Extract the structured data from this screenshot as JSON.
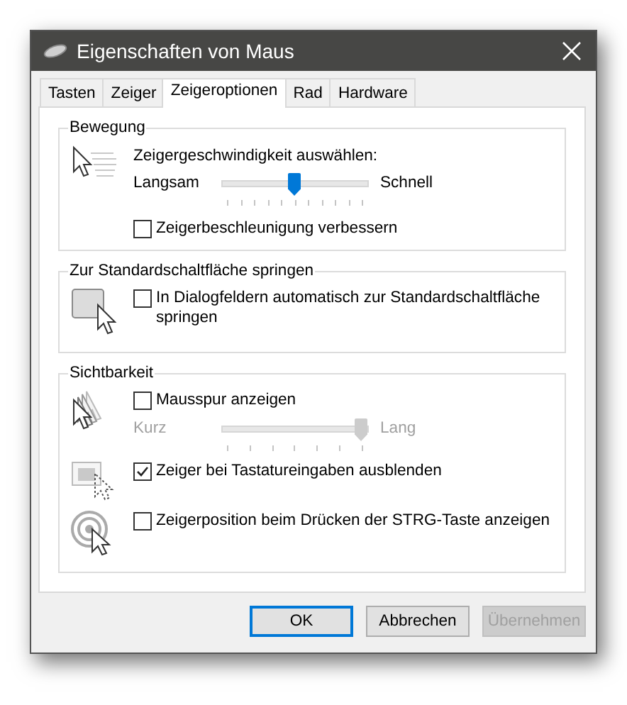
{
  "window": {
    "title": "Eigenschaften von Maus"
  },
  "tabs": [
    {
      "label": "Tasten",
      "selected": false
    },
    {
      "label": "Zeiger",
      "selected": false
    },
    {
      "label": "Zeigeroptionen",
      "selected": true
    },
    {
      "label": "Rad",
      "selected": false
    },
    {
      "label": "Hardware",
      "selected": false
    }
  ],
  "groups": [
    {
      "title": "Bewegung",
      "blocks": [
        {
          "rows": [
            {
              "kind": "label",
              "text": "Zeigergeschwindigkeit auswählen:"
            },
            {
              "kind": "slider",
              "min_label": "Langsam",
              "max_label": "Schnell",
              "level": 0.5,
              "disabled": false
            },
            {
              "kind": "checkbox",
              "label": "Zeigerbeschleunigung verbessern",
              "checked": false
            }
          ]
        }
      ]
    },
    {
      "title": "Zur Standardschaltfläche springen",
      "blocks": [
        {
          "rows": [
            {
              "kind": "checkbox",
              "label": "In Dialogfeldern automatisch zur Standardschaltfläche springen",
              "checked": false
            }
          ]
        }
      ]
    },
    {
      "title": "Sichtbarkeit",
      "blocks": [
        {
          "rows": [
            {
              "kind": "checkbox",
              "label": "Mausspur anzeigen",
              "checked": false
            },
            {
              "kind": "slider",
              "min_label": "Kurz",
              "max_label": "Lang",
              "level": 1,
              "disabled": true
            }
          ]
        },
        {
          "rows": [
            {
              "kind": "checkbox",
              "label": "Zeiger bei Tastatureingaben ausblenden",
              "checked": true
            }
          ]
        },
        {
          "rows": [
            {
              "kind": "checkbox",
              "label": "Zeigerposition beim Drücken der STRG-Taste anzeigen",
              "checked": false
            }
          ]
        }
      ]
    }
  ],
  "buttons": [
    {
      "label": "OK",
      "default": true,
      "disabled": false
    },
    {
      "label": "Abbrechen",
      "default": false,
      "disabled": false
    },
    {
      "label": "Übernehmen",
      "default": false,
      "disabled": true
    }
  ]
}
